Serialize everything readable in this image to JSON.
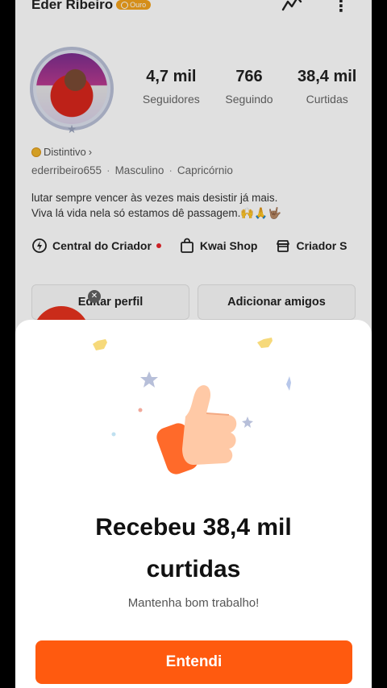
{
  "profile": {
    "name": "Eder Ribeiro",
    "level_badge": "Ouro",
    "stats": [
      {
        "value": "4,7 mil",
        "label": "Seguidores"
      },
      {
        "value": "766",
        "label": "Seguindo"
      },
      {
        "value": "38,4 mil",
        "label": "Curtidas"
      }
    ],
    "distintivo": "Distintivo",
    "username": "ederribeiro655",
    "gender": "Masculino",
    "sign": "Capricórnio",
    "bio_line1": "lutar sempre vencer às vezes mais desistir já mais.",
    "bio_line2": "Viva lá vida nela só estamos dê passagem.🙌🙏🤟🏽",
    "shortcuts": [
      {
        "label": "Central do Criador",
        "icon": "lightning-icon"
      },
      {
        "label": "Kwai Shop",
        "icon": "shopping-bag-icon"
      },
      {
        "label": "Criador S",
        "icon": "store-icon"
      }
    ],
    "edit_button": "Editar perfil",
    "add_friends_button": "Adicionar amigos"
  },
  "sheet": {
    "title_line1": "Recebeu 38,4 mil",
    "title_line2": "curtidas",
    "subtitle": "Mantenha bom trabalho!",
    "button": "Entendi",
    "illustration": "thumbs-up-icon"
  },
  "colors": {
    "accent": "#ff5a0f",
    "badge": "#f3a21d",
    "notification_dot": "#e8262c"
  }
}
